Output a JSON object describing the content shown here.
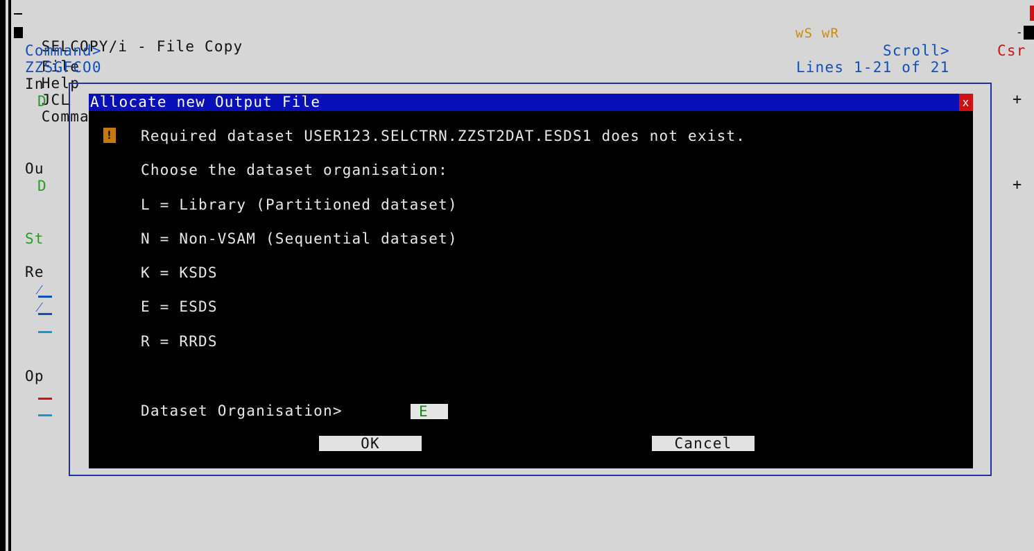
{
  "window": {
    "title": "SELCOPY/i - File Copy",
    "menu": [
      "File",
      "Help",
      "JCL",
      "Command"
    ],
    "indicators": "wS wR",
    "command_label": "Command>",
    "scroll_label": "Scroll>",
    "scroll_value": "Csr",
    "panel_id": "ZZSGFCO0",
    "lines_info": "Lines 1-21 of 21"
  },
  "background": {
    "labels": {
      "input": "In",
      "input_value": "D",
      "output": "Ou",
      "output_value": "D",
      "status": "St",
      "record": "Re",
      "options": "Op"
    },
    "expand_marker": "+"
  },
  "dialog": {
    "title": "Allocate new Output File",
    "close_glyph": "x",
    "warning_icon": "!",
    "message": "Required dataset USER123.SELCTRN.ZZST2DAT.ESDS1 does not exist.",
    "prompt": "Choose the dataset organisation:",
    "options": [
      "L = Library (Partitioned dataset)",
      "N = Non-VSAM (Sequential dataset)",
      "K = KSDS",
      "E = ESDS",
      "R = RRDS"
    ],
    "field_label": "Dataset Organisation>",
    "field_value": "E",
    "ok_label": "OK",
    "cancel_label": "Cancel"
  },
  "colors": {
    "background": "#d6d6d6",
    "dialog_bg": "#000000",
    "dialog_title_bg": "#0a10b8",
    "frame": "#1e2fa8",
    "header_text": "#0d4fbf",
    "field_text": "#118811",
    "indicator": "#d08a00",
    "close": "#d01010"
  }
}
